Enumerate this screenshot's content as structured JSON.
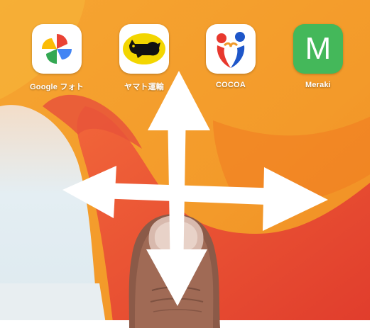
{
  "apps": [
    {
      "label": "Google フォト",
      "icon": "google-photos-icon"
    },
    {
      "label": "ヤマト運輸",
      "icon": "yamato-transport-icon"
    },
    {
      "label": "COCOA",
      "icon": "cocoa-icon"
    },
    {
      "label": "Meraki",
      "icon": "meraki-icon",
      "letter": "M"
    }
  ],
  "overlay": {
    "gesture": "four-way-pan-arrows-icon"
  },
  "colors": {
    "wallpaper_orange": "#f39a2a",
    "wallpaper_red": "#e8452f",
    "wallpaper_light": "#e6f0f5",
    "meraki_green": "#44b85a",
    "yamato_yellow": "#f3d600",
    "arrow_white": "#ffffff"
  }
}
